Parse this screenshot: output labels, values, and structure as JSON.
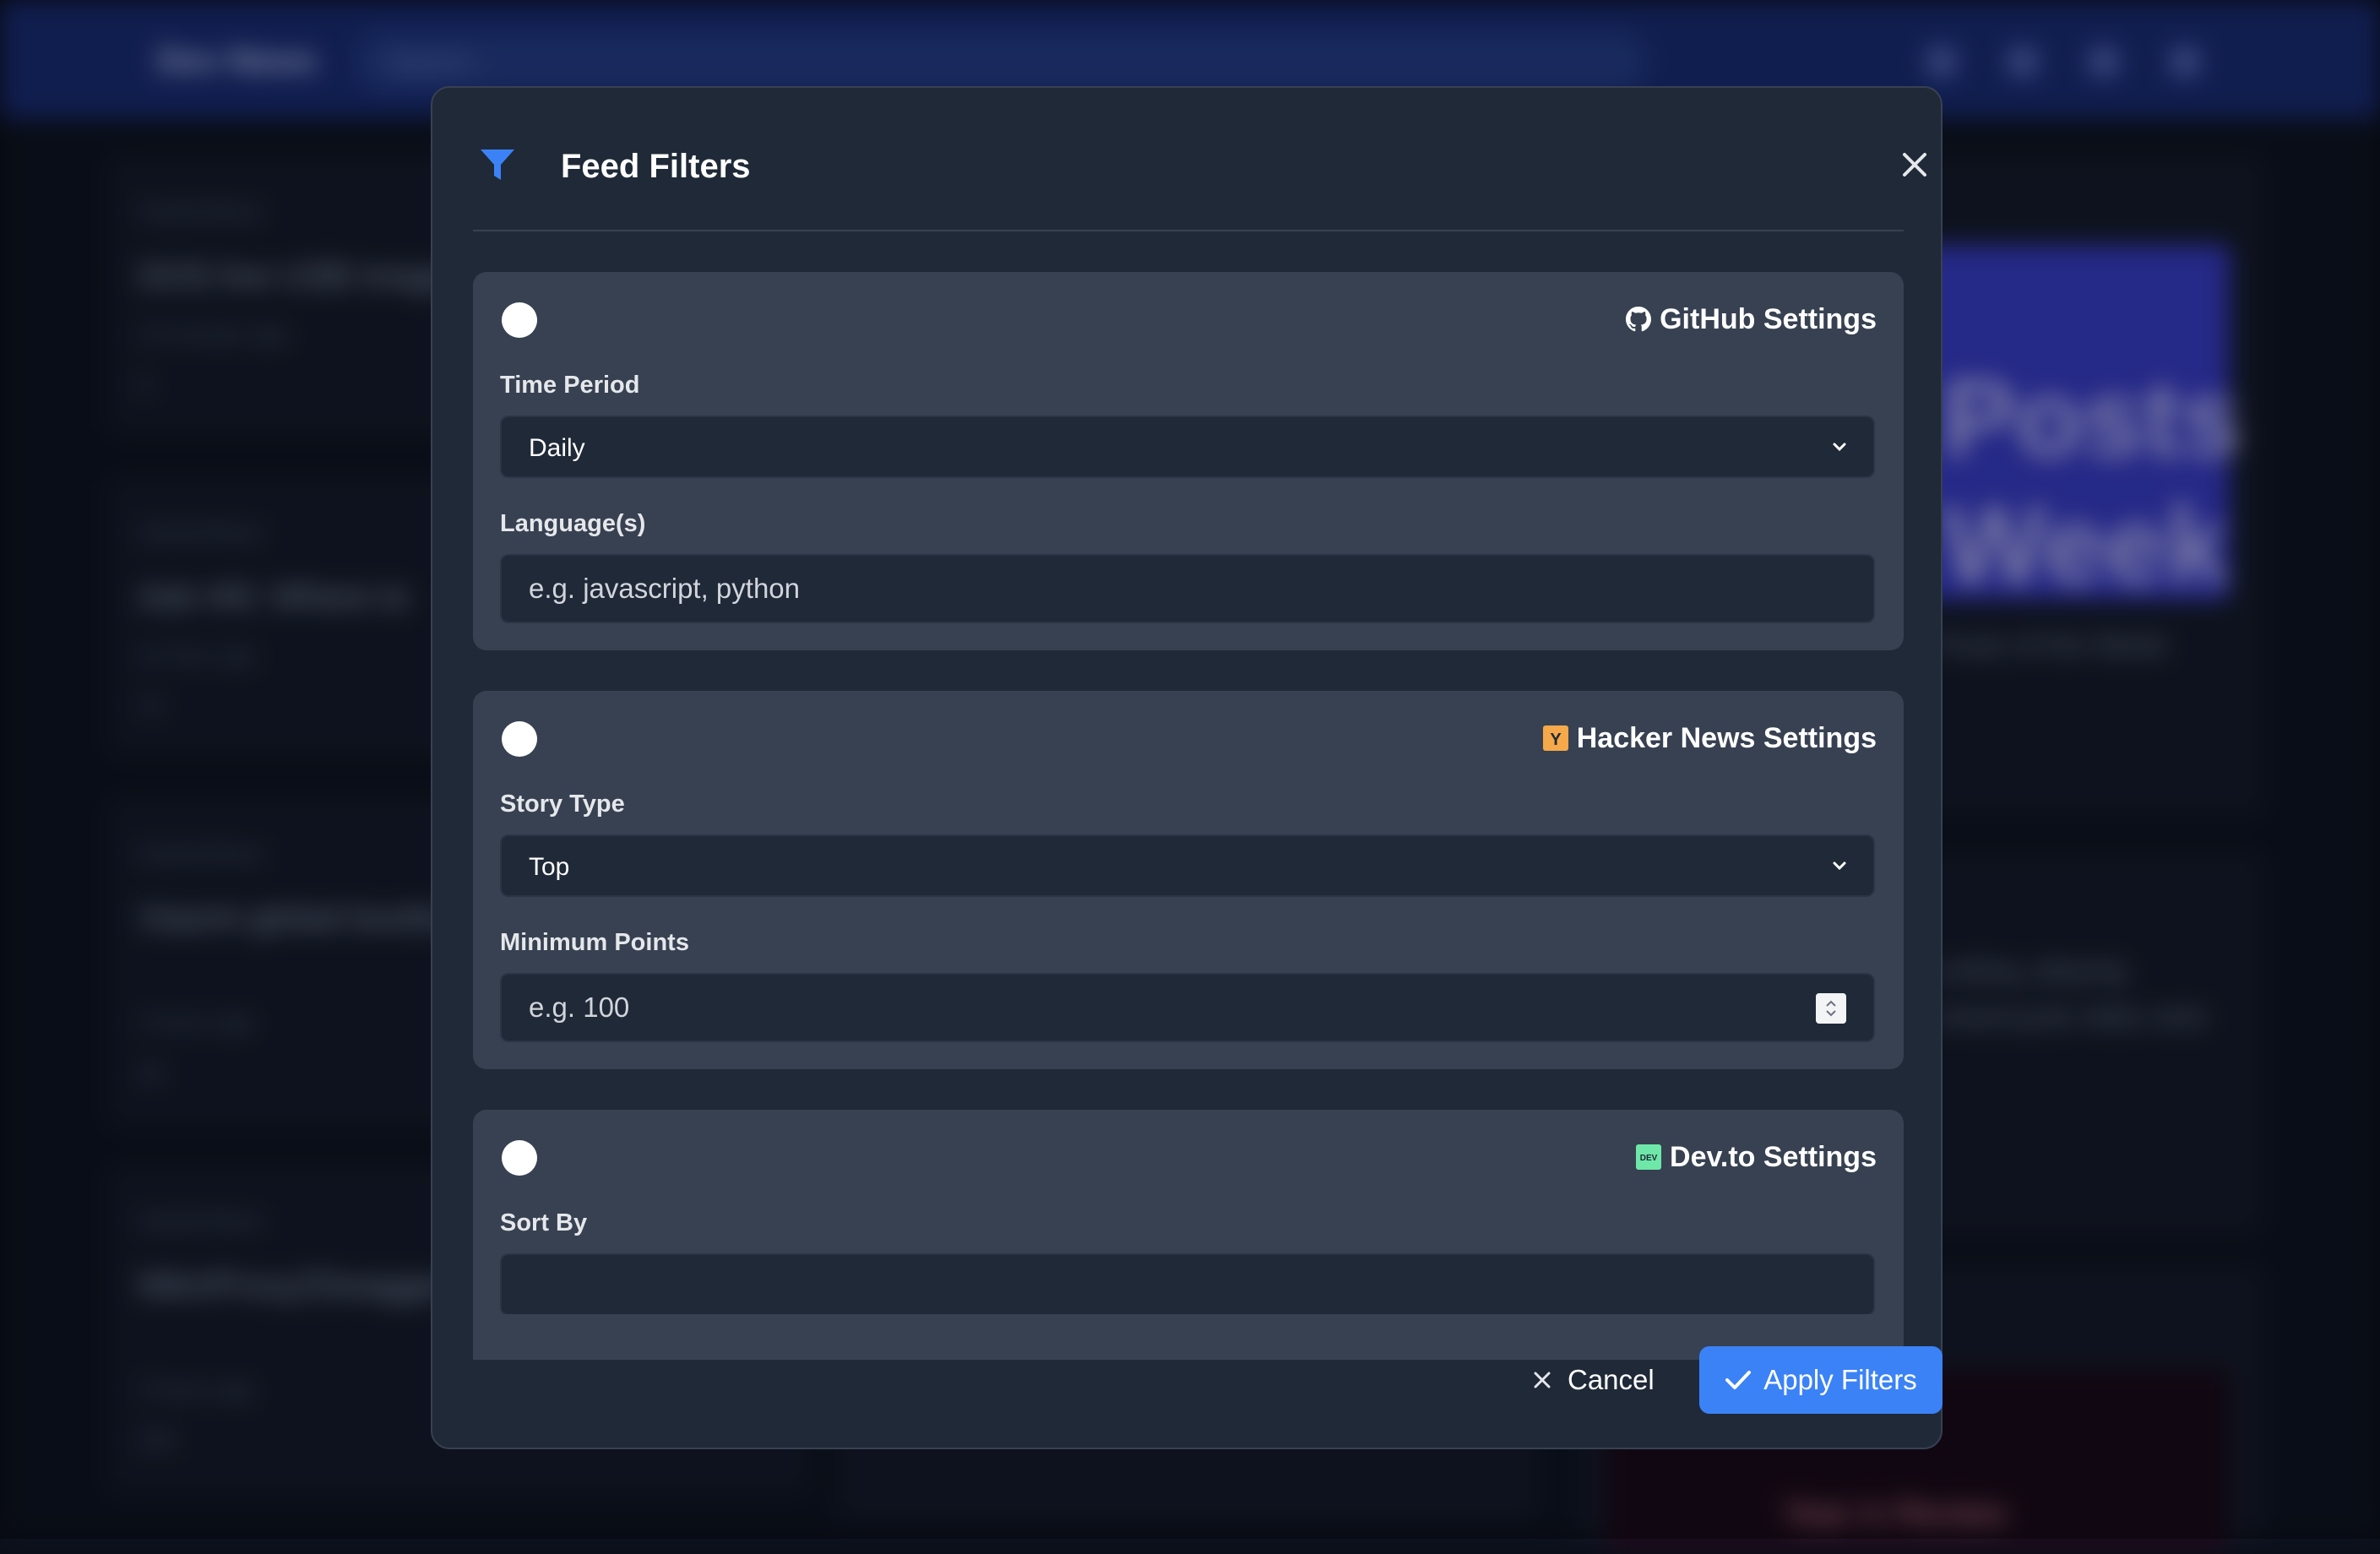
{
  "background": {
    "brand": "Dev News",
    "search_placeholder": "Search...",
    "cards": [
      {
        "source": "HackerNews",
        "title": "DOS live USB image",
        "time": "15 minutes ago",
        "points": "6",
        "comments": "0"
      },
      {
        "source": "HackerNews",
        "title": "Ask HN: Where to",
        "time": "an hour ago",
        "points": "15",
        "comments": "14"
      },
      {
        "source": "HackerNews",
        "title": "Xiaomi global bootloader changed",
        "time": "2 hours ago",
        "points": "36",
        "comments": "27"
      },
      {
        "source": "HackerNews",
        "title": "MitmProxy2Swagger: reverse-engineer",
        "time": "3 hours ago",
        "points": "205",
        "comments": "60"
      }
    ],
    "right_panel": {
      "image_text_1": "Posts",
      "image_text_2": "Week",
      "caption": "Posts of the Week",
      "card_text_1": "coding, playing",
      "card_text_2": "motorcycle rides next",
      "image_b_text": "Year in Review"
    }
  },
  "modal": {
    "title": "Feed Filters",
    "funnel_icon": "funnel-icon",
    "close_icon": "close-icon",
    "accent_color": "#3b82f6",
    "sections": {
      "github": {
        "title": "GitHub Settings",
        "icon": "github-icon",
        "enabled": false,
        "time_period_label": "Time Period",
        "time_period_value": "Daily",
        "languages_label": "Language(s)",
        "languages_placeholder": "e.g. javascript, python",
        "languages_value": ""
      },
      "hackernews": {
        "title": "Hacker News Settings",
        "icon": "hackernews-icon",
        "icon_letter": "Y",
        "enabled": false,
        "story_type_label": "Story Type",
        "story_type_value": "Top",
        "min_points_label": "Minimum Points",
        "min_points_placeholder": "e.g. 100",
        "min_points_value": ""
      },
      "devto": {
        "title": "Dev.to Settings",
        "icon": "devto-icon",
        "icon_text": "DEV",
        "enabled": false,
        "sort_by_label": "Sort By"
      }
    },
    "footer": {
      "cancel_label": "Cancel",
      "apply_label": "Apply Filters"
    }
  }
}
